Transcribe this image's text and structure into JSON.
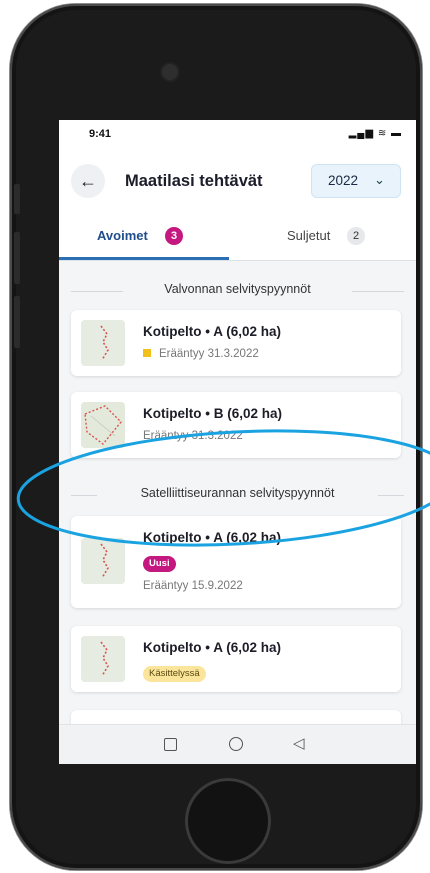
{
  "status_bar": {
    "time": "9:41",
    "icons": "▂▄▆ ≋ ▬"
  },
  "header": {
    "back_icon": "←",
    "title": "Maatilasi tehtävät",
    "year_select": {
      "value": "2022",
      "chevron": "⌄"
    }
  },
  "tabs": [
    {
      "label": "Avoimet",
      "count": "3",
      "active": true
    },
    {
      "label": "Suljetut",
      "count": "2",
      "active": false
    }
  ],
  "sections": [
    {
      "heading": "Valvonnan selvityspyynnöt",
      "items": [
        {
          "title": "Kotipelto • A (6,02 ha)",
          "due": "Erääntyy 31.3.2022"
        },
        {
          "title": "Kotipelto • B (6,02 ha)",
          "due": "Erääntyy 31.3.2022"
        }
      ]
    },
    {
      "heading": "Satelliittiseurannan selvityspyynnöt",
      "items": [
        {
          "title": "Kotipelto • A (6,02 ha)",
          "tag": "Uusi",
          "due": "Erääntyy 15.9.2022"
        },
        {
          "title": "Kotipelto • A (6,02 ha)",
          "tag": "Käsittelyssä"
        }
      ]
    }
  ],
  "colors": {
    "accent": "#2a6fb4",
    "badge": "#c4177f",
    "due_marker": "#f2c01b",
    "annotation": "#1aa3e0"
  }
}
